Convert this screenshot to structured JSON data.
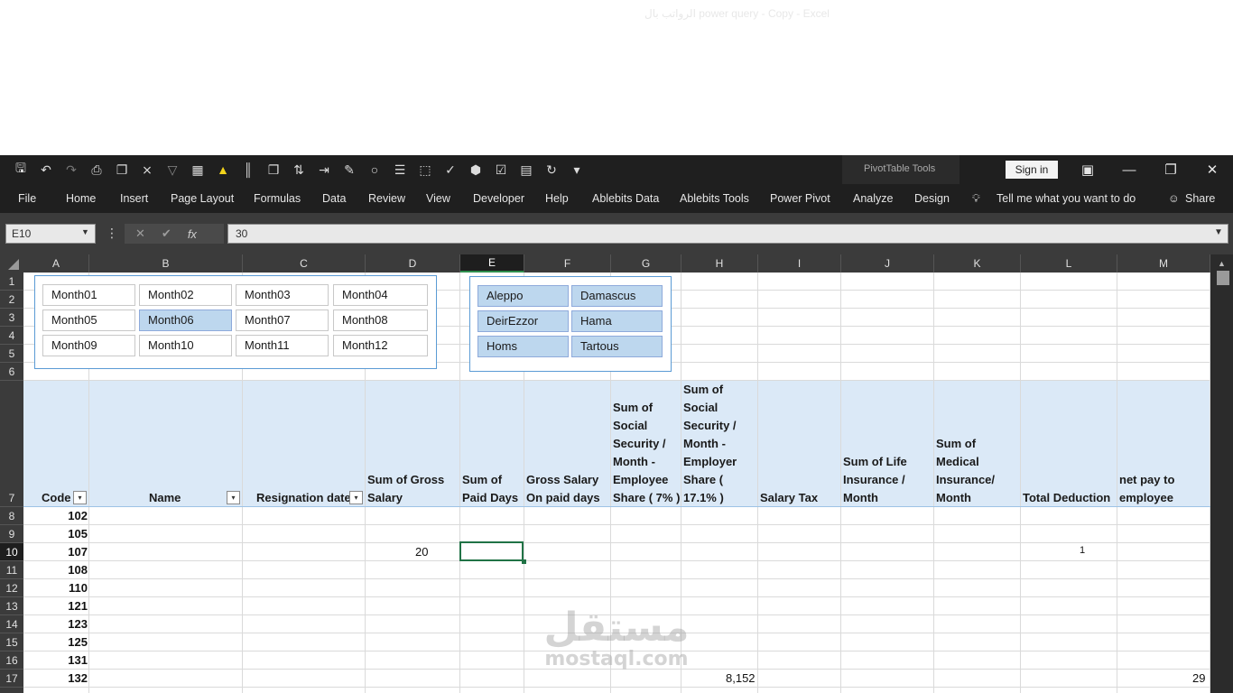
{
  "window": {
    "title": "الرواتب بال power query - Copy  -  Excel",
    "pivot_tools": "PivotTable Tools",
    "sign_in": "Sign in"
  },
  "ribbon": {
    "tabs": [
      "File",
      "Home",
      "Insert",
      "Page Layout",
      "Formulas",
      "Data",
      "Review",
      "View",
      "Developer",
      "Help",
      "Ablebits Data",
      "Ablebits Tools",
      "Power Pivot",
      "Analyze",
      "Design"
    ],
    "tell_me": "Tell me what you want to do",
    "share": "Share"
  },
  "formula_bar": {
    "name_box": "E10",
    "formula": "30",
    "fx": "fx"
  },
  "columns": [
    "A",
    "B",
    "C",
    "D",
    "E",
    "F",
    "G",
    "H",
    "I",
    "J",
    "K",
    "L",
    "M"
  ],
  "selected_column": "E",
  "rows": [
    "1",
    "2",
    "3",
    "4",
    "5",
    "6",
    "7",
    "8",
    "9",
    "10",
    "11",
    "12",
    "13",
    "14",
    "15",
    "16",
    "17"
  ],
  "selected_row": "10",
  "slicers": {
    "months": {
      "items": [
        "Month01",
        "Month02",
        "Month03",
        "Month04",
        "Month05",
        "Month06",
        "Month07",
        "Month08",
        "Month09",
        "Month10",
        "Month11",
        "Month12"
      ],
      "selected": "Month06"
    },
    "cities": {
      "items": [
        "Aleppo",
        "Damascus",
        "DeirEzzor",
        "Hama",
        "Homs",
        "Tartous"
      ],
      "selected": [
        "Aleppo",
        "Damascus",
        "DeirEzzor",
        "Hama",
        "Homs",
        "Tartous"
      ]
    }
  },
  "pivot_headers": {
    "code": "Code",
    "name": "Name",
    "resignation_date": "Resignation date",
    "gross_salary": "Sum of Gross\nSalary",
    "paid_days": "Sum of\nPaid Days",
    "gross_on_paid": "Gross Salary\nOn paid days",
    "ss_employee": "Sum of\nSocial\nSecurity /\nMonth -\nEmployee\nShare ( 7% )",
    "ss_employer": "Sum of\nSocial\nSecurity /\nMonth -\nEmployer\nShare (\n17.1% )",
    "salary_tax": "Salary Tax",
    "life_insurance": "Sum of Life\nInsurance /\nMonth",
    "medical_insurance": "Sum of\nMedical\nInsurance/\nMonth",
    "total_deduction": "Total Deduction",
    "net_pay": "net pay to\nemployee"
  },
  "codes": [
    "102",
    "105",
    "107",
    "108",
    "110",
    "121",
    "123",
    "125",
    "131",
    "132"
  ],
  "partial_values": {
    "d10": "20",
    "l10": "1",
    "h17": "8,152",
    "m17": "29"
  },
  "watermark": {
    "arabic": "مستقل",
    "latin": "mostaql.com"
  }
}
